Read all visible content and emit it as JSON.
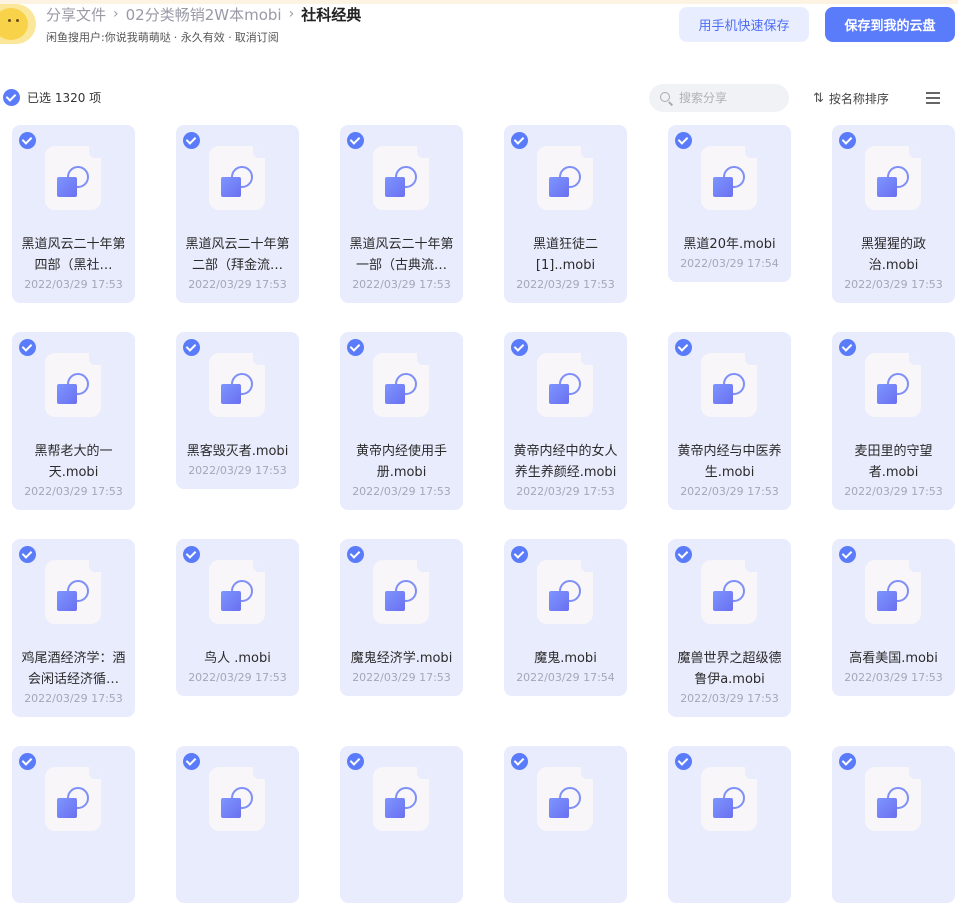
{
  "header": {
    "breadcrumb": [
      {
        "label": "分享文件"
      },
      {
        "label": "02分类畅销2W本mobi"
      },
      {
        "label": "社科经典"
      }
    ],
    "separator": "›",
    "sharer": "闲鱼搜用户:你说我萌萌哒",
    "validity": "· 永久有效 ·",
    "unsubscribe": "取消订阅",
    "phone_save_label": "用手机快速保存",
    "save_label": "保存到我的云盘"
  },
  "toolbar": {
    "selected_text": "已选 1320 项",
    "search_placeholder": "搜索分享",
    "sort_label": "按名称排序"
  },
  "colors": {
    "accent": "#5b7cfa",
    "card_bg": "#e9ecfd"
  },
  "files": [
    {
      "name": "黑道风云二十年第四部（黑社…",
      "date": "2022/03/29 17:53"
    },
    {
      "name": "黑道风云二十年第二部（拜金流…",
      "date": "2022/03/29 17:53"
    },
    {
      "name": "黑道风云二十年第一部（古典流…",
      "date": "2022/03/29 17:53"
    },
    {
      "name": "黑道狂徒二[1]..mobi",
      "date": "2022/03/29 17:53"
    },
    {
      "name": "黑道20年.mobi",
      "date": "2022/03/29 17:54"
    },
    {
      "name": "黑猩猩的政治.mobi",
      "date": "2022/03/29 17:53"
    },
    {
      "name": "黑帮老大的一天.mobi",
      "date": "2022/03/29 17:53"
    },
    {
      "name": "黑客毁灭者.mobi",
      "date": "2022/03/29 17:53"
    },
    {
      "name": "黄帝内经使用手册.mobi",
      "date": "2022/03/29 17:53"
    },
    {
      "name": "黄帝内经中的女人养生养颜经.mobi",
      "date": "2022/03/29 17:53"
    },
    {
      "name": "黄帝内经与中医养生.mobi",
      "date": "2022/03/29 17:53"
    },
    {
      "name": "麦田里的守望者.mobi",
      "date": "2022/03/29 17:53"
    },
    {
      "name": "鸡尾酒经济学：酒会闲话经济循…",
      "date": "2022/03/29 17:53"
    },
    {
      "name": "鸟人 .mobi",
      "date": "2022/03/29 17:53"
    },
    {
      "name": "魔鬼经济学.mobi",
      "date": "2022/03/29 17:53"
    },
    {
      "name": "魔鬼.mobi",
      "date": "2022/03/29 17:54"
    },
    {
      "name": "魔兽世界之超级德鲁伊a.mobi",
      "date": "2022/03/29 17:53"
    },
    {
      "name": "高看美国.mobi",
      "date": "2022/03/29 17:53"
    },
    {
      "name": "",
      "date": ""
    },
    {
      "name": "",
      "date": ""
    },
    {
      "name": "",
      "date": ""
    },
    {
      "name": "",
      "date": ""
    },
    {
      "name": "",
      "date": ""
    },
    {
      "name": "",
      "date": ""
    }
  ]
}
